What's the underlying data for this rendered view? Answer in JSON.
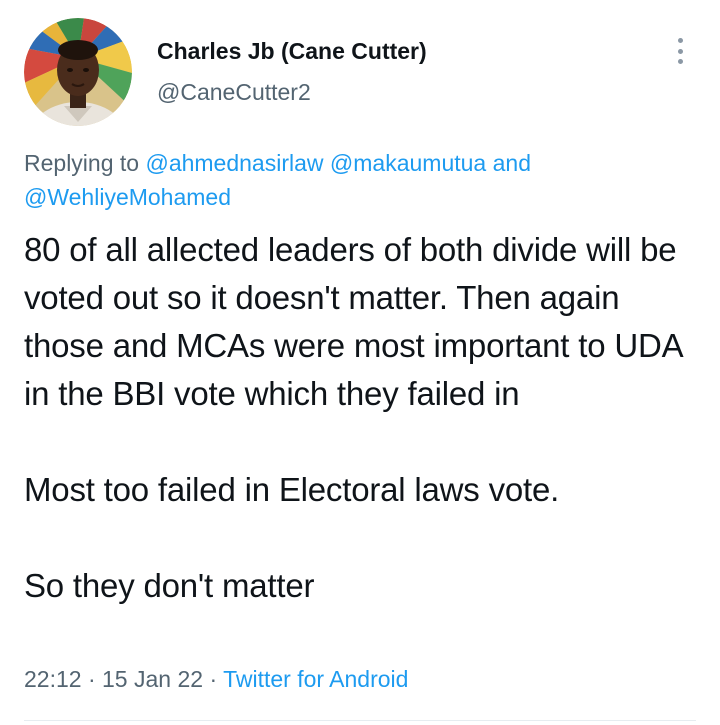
{
  "author": {
    "display_name": "Charles Jb (Cane Cutter)",
    "handle": "@CaneCutter2"
  },
  "reply": {
    "prefix": "Replying to",
    "mentions": [
      "@ahmednasirlaw",
      "@makaumutua",
      "@WehliyeMohamed"
    ],
    "joiner": "and"
  },
  "tweet": {
    "text": "80 of all allected leaders of both divide will be voted out so it doesn't matter. Then again those and MCAs were most important to UDA in the BBI vote which they failed in\n\nMost too failed in Electoral laws vote.\n\nSo they don't matter"
  },
  "meta": {
    "time": "22:12",
    "separator": "·",
    "date": "15 Jan 22",
    "source": "Twitter for Android"
  },
  "icons": {
    "more": "more-vertical-icon"
  },
  "colors": {
    "text": "#0f1419",
    "secondary": "#536471",
    "link": "#1d9bf0"
  }
}
